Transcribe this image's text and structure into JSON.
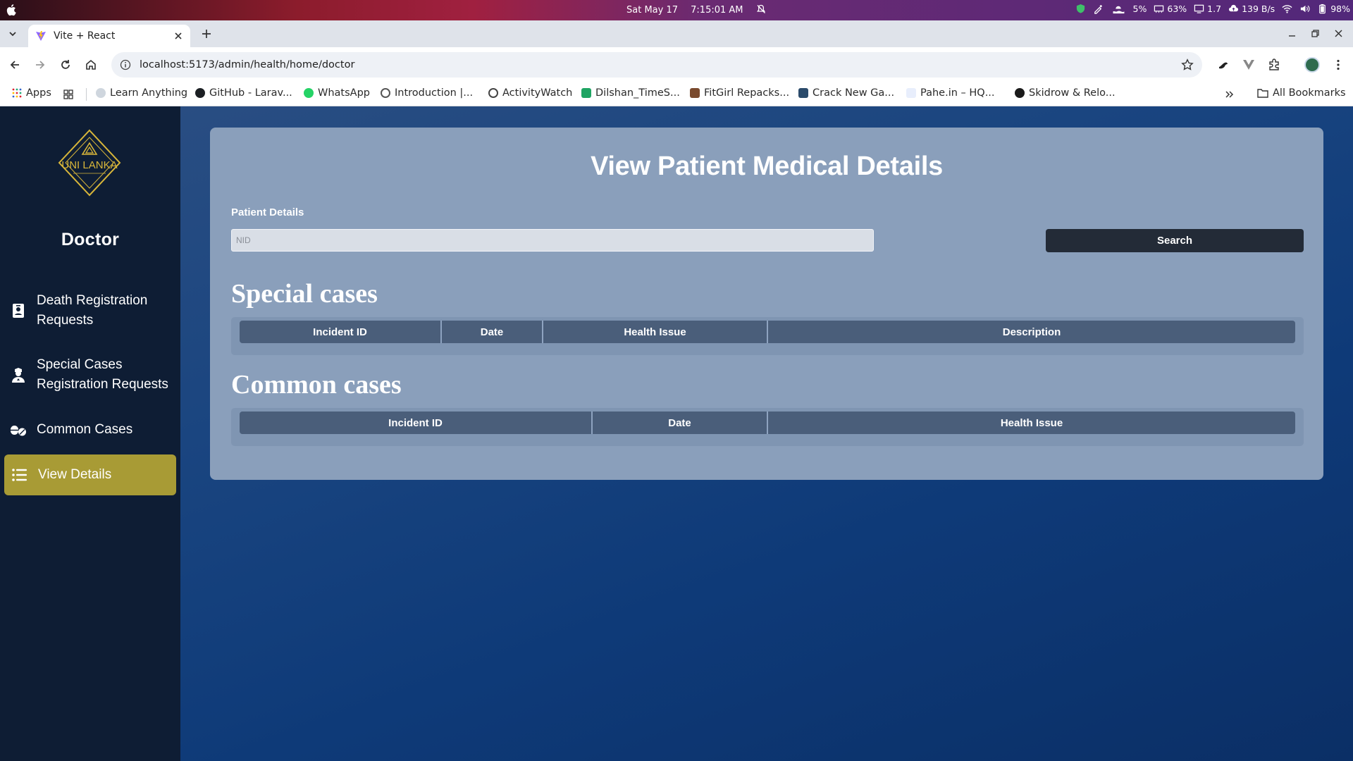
{
  "os_bar": {
    "date": "Sat May 17",
    "time": "7:15:01 AM",
    "cpu": "5%",
    "memory": "63%",
    "load": "1.7",
    "network": "139 B/s",
    "battery": "98%"
  },
  "browser": {
    "tab_title": "Vite + React",
    "url": "localhost:5173/admin/health/home/doctor"
  },
  "bookmarks": [
    {
      "label": "Apps",
      "icon": "apps-grid-icon"
    },
    {
      "label": "Learn Anything",
      "icon": "learn-anything-icon"
    },
    {
      "label": "GitHub - Larav...",
      "icon": "github-icon"
    },
    {
      "label": "WhatsApp",
      "icon": "whatsapp-icon"
    },
    {
      "label": "Introduction |...",
      "icon": "introduction-icon"
    },
    {
      "label": "ActivityWatch",
      "icon": "activitywatch-icon"
    },
    {
      "label": "Dilshan_TimeS...",
      "icon": "sheets-icon"
    },
    {
      "label": "FitGirl Repacks...",
      "icon": "fitgirl-icon"
    },
    {
      "label": "Crack New Ga...",
      "icon": "crack-icon"
    },
    {
      "label": "Pahe.in – HQ...",
      "icon": "pahe-icon"
    },
    {
      "label": "Skidrow & Relo...",
      "icon": "skidrow-icon"
    }
  ],
  "all_bookmarks": "All Bookmarks",
  "sidebar": {
    "logo_text": "UNI LANKA",
    "role": "Doctor",
    "items": [
      {
        "label": "Death Registration Requests",
        "icon": "id-badge-icon",
        "active": false
      },
      {
        "label": "Special Cases Registration Requests",
        "icon": "user-nurse-icon",
        "active": false
      },
      {
        "label": "Common Cases",
        "icon": "pills-icon",
        "active": false
      },
      {
        "label": "View Details",
        "icon": "list-icon",
        "active": true
      }
    ]
  },
  "main": {
    "title": "View Patient Medical Details",
    "field_label": "Patient Details",
    "nid_placeholder": "NID",
    "search_label": "Search",
    "special_title": "Special cases",
    "special_columns": [
      "Incident ID",
      "Date",
      "Health Issue",
      "Description"
    ],
    "common_title": "Common cases",
    "common_columns": [
      "Incident ID",
      "Date",
      "Health Issue"
    ]
  },
  "colors": {
    "sidebar_bg": "#0e1d34",
    "active_item": "#a89b35",
    "panel_bg": "#8a9fbb",
    "header_cell": "#4a5e7a",
    "search_button": "#232b37"
  }
}
